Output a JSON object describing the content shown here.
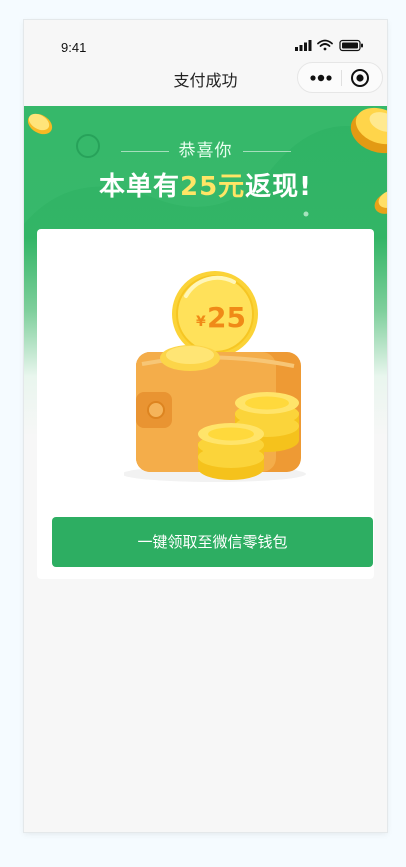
{
  "status_bar": {
    "time": "9:41"
  },
  "nav": {
    "title": "支付成功"
  },
  "banner": {
    "congrats": "恭喜你",
    "headline_prefix": "本单有",
    "headline_amount": "25元",
    "headline_suffix": "返现!"
  },
  "card": {
    "coin_currency": "¥",
    "coin_value": "25",
    "button_label": "一键领取至微信零钱包"
  },
  "colors": {
    "brand_green": "#2dae62",
    "highlight_yellow": "#ffe566",
    "coin_orange": "#f09a1a"
  }
}
